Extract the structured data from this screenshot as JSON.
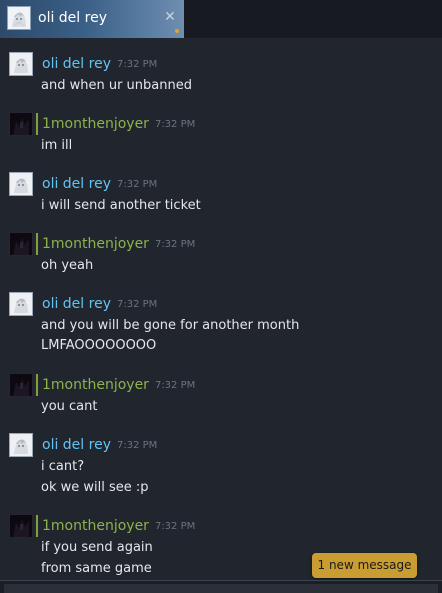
{
  "tab": {
    "title": "oli del rey",
    "close_icon": "close-icon",
    "avatar_icon": "anime-avatar-icon",
    "unread_indicator_color": "#e8a32a"
  },
  "colors": {
    "sender_self": "#62c3f3",
    "sender_friend": "#8db24e",
    "accent_tab": "#3a5f86",
    "new_message_pill": "#c99d32"
  },
  "messages": [
    {
      "sender": "oli del rey",
      "time": "7:32 PM",
      "lines": [
        "and when ur unbanned"
      ]
    },
    {
      "sender": "1monthenjoyer",
      "time": "7:32 PM",
      "lines": [
        "im ill"
      ]
    },
    {
      "sender": "oli del rey",
      "time": "7:32 PM",
      "lines": [
        "i will send another ticket"
      ]
    },
    {
      "sender": "1monthenjoyer",
      "time": "7:32 PM",
      "lines": [
        "oh yeah"
      ]
    },
    {
      "sender": "oli del rey",
      "time": "7:32 PM",
      "lines": [
        "and you will be gone for another month",
        "LMFAOOOOOOOO"
      ]
    },
    {
      "sender": "1monthenjoyer",
      "time": "7:32 PM",
      "lines": [
        "you cant"
      ]
    },
    {
      "sender": "oli del rey",
      "time": "7:32 PM",
      "lines": [
        "i cant?",
        "ok we will see :p"
      ]
    },
    {
      "sender": "1monthenjoyer",
      "time": "7:32 PM",
      "lines": [
        "if you send again",
        "from same game"
      ]
    }
  ],
  "new_message_button": "1 new message",
  "input": {
    "value": ""
  }
}
